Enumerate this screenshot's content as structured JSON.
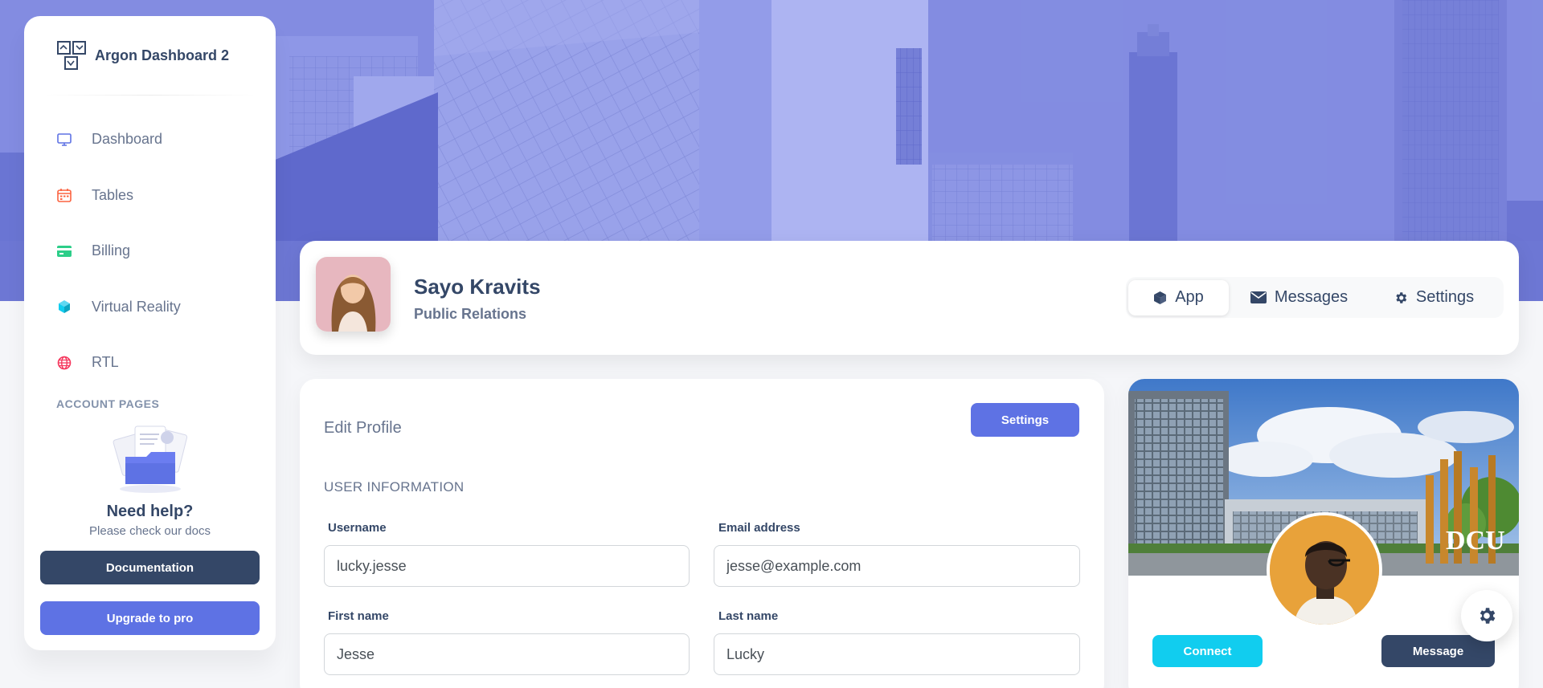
{
  "brand": {
    "name": "Argon Dashboard 2"
  },
  "sidebar": {
    "items": [
      {
        "label": "Dashboard",
        "icon": "tv-icon"
      },
      {
        "label": "Tables",
        "icon": "calendar-icon"
      },
      {
        "label": "Billing",
        "icon": "credit-card-icon"
      },
      {
        "label": "Virtual Reality",
        "icon": "box-3d-icon"
      },
      {
        "label": "RTL",
        "icon": "globe-icon"
      }
    ],
    "section_title": "ACCOUNT PAGES",
    "help": {
      "title": "Need help?",
      "subtitle": "Please check our docs",
      "doc_button": "Documentation",
      "upgrade_button": "Upgrade to pro"
    }
  },
  "profile": {
    "name": "Sayo Kravits",
    "role": "Public Relations",
    "tabs": [
      {
        "label": "App",
        "icon": "cube-icon",
        "active": true
      },
      {
        "label": "Messages",
        "icon": "envelope-icon",
        "active": false
      },
      {
        "label": "Settings",
        "icon": "gear-icon",
        "active": false
      }
    ]
  },
  "edit_profile": {
    "title": "Edit Profile",
    "settings_button": "Settings",
    "section": "USER INFORMATION",
    "fields": {
      "username": {
        "label": "Username",
        "value": "lucky.jesse"
      },
      "email": {
        "label": "Email address",
        "value": "jesse@example.com"
      },
      "first_name": {
        "label": "First name",
        "value": "Jesse"
      },
      "last_name": {
        "label": "Last name",
        "value": "Lucky"
      }
    }
  },
  "profile_card": {
    "cover_sign": "DCU",
    "connect_button": "Connect",
    "message_button": "Message"
  },
  "colors": {
    "primary": "#5e72e4",
    "dark": "#344767",
    "info": "#11cdef",
    "text_muted": "#67748e"
  }
}
